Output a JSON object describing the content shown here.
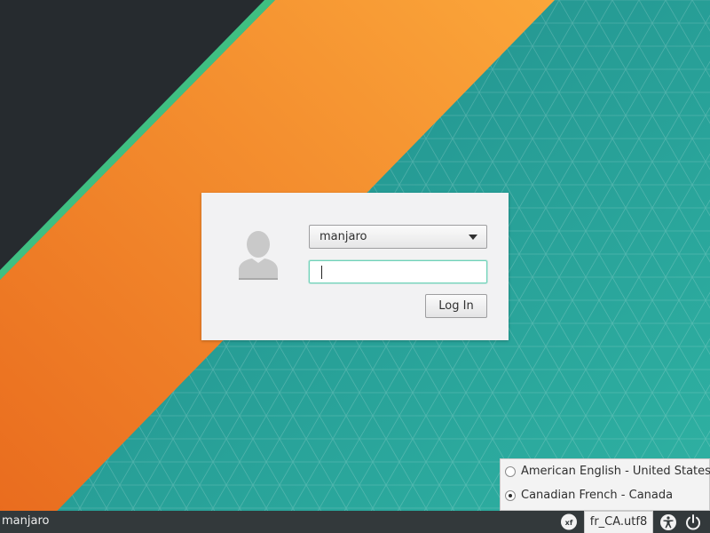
{
  "login": {
    "username": "manjaro",
    "password_value": "",
    "login_label": "Log In"
  },
  "language_menu": {
    "items": [
      {
        "label": "American English - United States",
        "selected": false
      },
      {
        "label": "Canadian French - Canada",
        "selected": true
      }
    ]
  },
  "panel": {
    "hostname": "manjaro",
    "locale": "fr_CA.utf8",
    "icons": [
      "xfce-icon",
      "accessibility-icon",
      "power-icon"
    ]
  },
  "colors": {
    "dark_band": "#262b2f",
    "green_stripe": "#3fbf82",
    "orange_start": "#e96b1e",
    "orange_end": "#fba63a",
    "teal": "#2a9d96",
    "panel_bg": "#33393b",
    "focus_ring": "#6fd2b8"
  }
}
